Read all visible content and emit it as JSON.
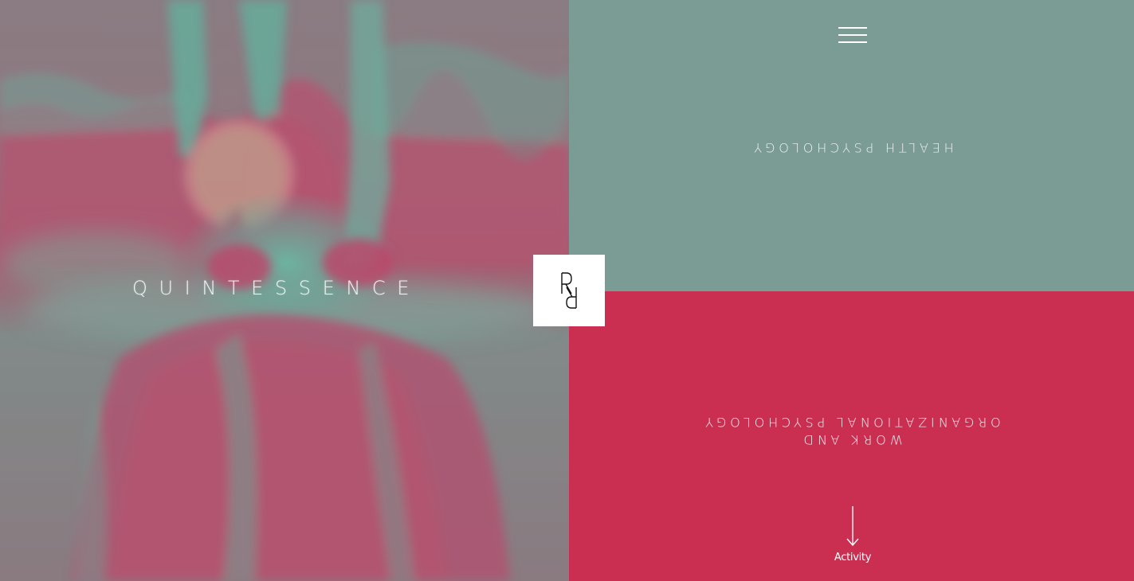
{
  "hero": {
    "title": "QUINTESSENCE",
    "image_icon": "duotone-portrait-photo"
  },
  "header": {
    "menu_icon": "hamburger-menu-icon"
  },
  "logo": {
    "icon": "rr-monogram-logo"
  },
  "sections": {
    "health": {
      "label": "HEALTH PSYCHOLOGY"
    },
    "work": {
      "line1": "WORK AND",
      "line2": "ORGANIZATIONAL PSYCHOLOGY"
    }
  },
  "activity": {
    "label": "Activity",
    "icon": "arrow-down-icon"
  },
  "colors": {
    "teal": "#7a9c95",
    "crimson": "#ca2f52",
    "hero_teal": "#5fb59f",
    "hero_pink": "#c24a6b",
    "white": "#ffffff"
  }
}
